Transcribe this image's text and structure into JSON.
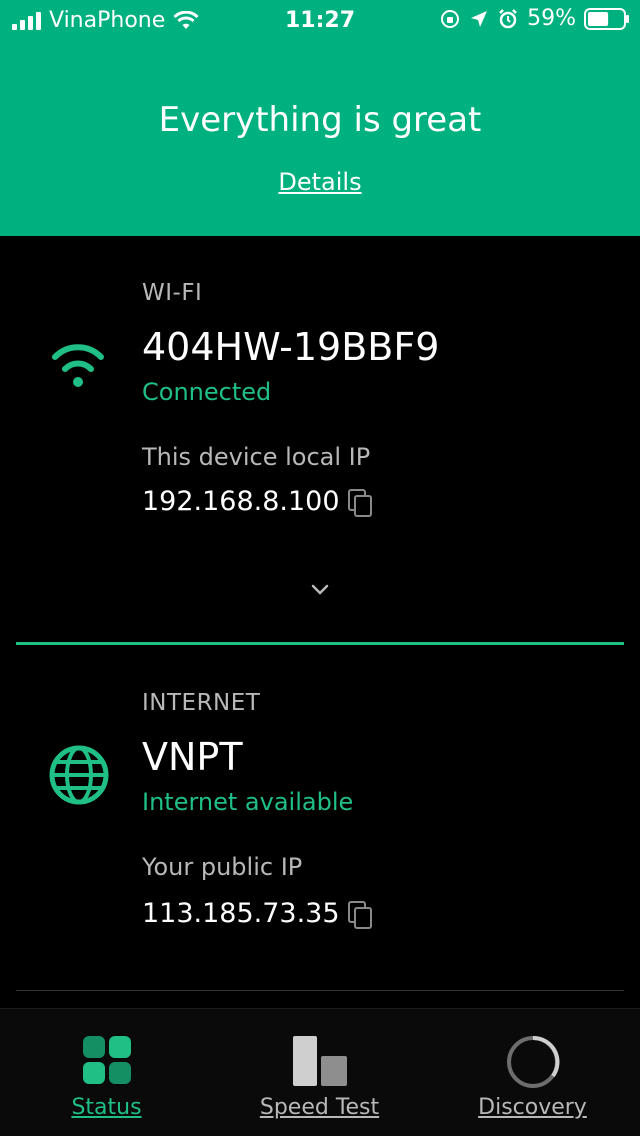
{
  "status_bar": {
    "carrier": "VinaPhone",
    "time": "11:27",
    "battery": "59%",
    "battery_level": 0.59
  },
  "header": {
    "title": "Everything is great",
    "link": "Details",
    "background": "#00b180"
  },
  "wifi": {
    "section_label": "WI-FI",
    "network_name": "404HW-19BBF9",
    "status": "Connected",
    "ip_label": "This device local IP",
    "ip": "192.168.8.100"
  },
  "internet": {
    "section_label": "INTERNET",
    "provider": "VNPT",
    "status": "Internet available",
    "ip_label": "Your public IP",
    "ip": "113.185.73.35"
  },
  "tabs": [
    {
      "label": "Status",
      "icon": "grid-icon",
      "active": true,
      "color": "#1fbf86"
    },
    {
      "label": "Speed Test",
      "icon": "bars-icon",
      "active": false,
      "color": "#b8b8b8"
    },
    {
      "label": "Discovery",
      "icon": "radar-icon",
      "active": false,
      "color": "#b8b8b8"
    }
  ],
  "accent": "#1fbf86"
}
